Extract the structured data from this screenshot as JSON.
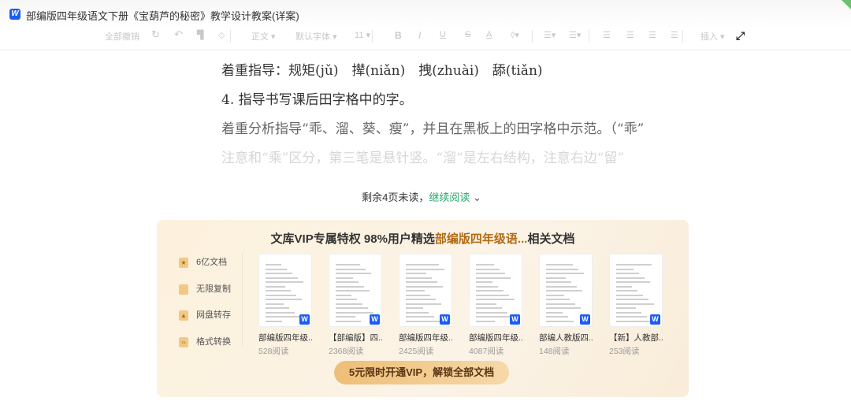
{
  "window": {
    "title": "部编版四年级语文下册《宝葫芦的秘密》教学设计教案(详案)",
    "logo": "W"
  },
  "toolbar": {
    "undo_all": "全部撤销",
    "style": "正文",
    "font": "默认字体",
    "size": "11",
    "bold": "B",
    "italic": "I",
    "underline": "U",
    "strike": "S",
    "color": "A",
    "insert": "插入"
  },
  "content": {
    "lines": [
      "着重指导：规矩(jǔ)　撵(niǎn)　拽(zhuài)　舔(tiǎn)",
      "4. 指导书写课后田字格中的字。",
      "着重分析指导“乖、溜、葵、瘦”，并且在黑板上的田字格中示范。（“乖”",
      "注意和“乘”区分，第三笔是悬针竖。“溜”是左右结构，注意右边“留”"
    ]
  },
  "more": {
    "remaining": "剩余4页未读，",
    "continue": "继续阅读"
  },
  "banner": {
    "title_prefix": "文库VIP专属特权 98%用户精选",
    "title_highlight": "部编版四年级语...",
    "title_suffix": "相关文档",
    "features": [
      "6亿文档",
      "无限复制",
      "网盘转存",
      "格式转换"
    ],
    "docs": [
      {
        "title": "部编版四年级...",
        "reads": "528阅读"
      },
      {
        "title": "【部编版】四...",
        "reads": "2368阅读"
      },
      {
        "title": "部编版四年级...",
        "reads": "2425阅读"
      },
      {
        "title": "部编版四年级...",
        "reads": "4087阅读"
      },
      {
        "title": "部编人教版四...",
        "reads": "148阅读"
      },
      {
        "title": "【新】人教部...",
        "reads": "253阅读"
      }
    ],
    "doc_badge": "W",
    "cta": "5元限时开通VIP，解锁全部文档"
  }
}
